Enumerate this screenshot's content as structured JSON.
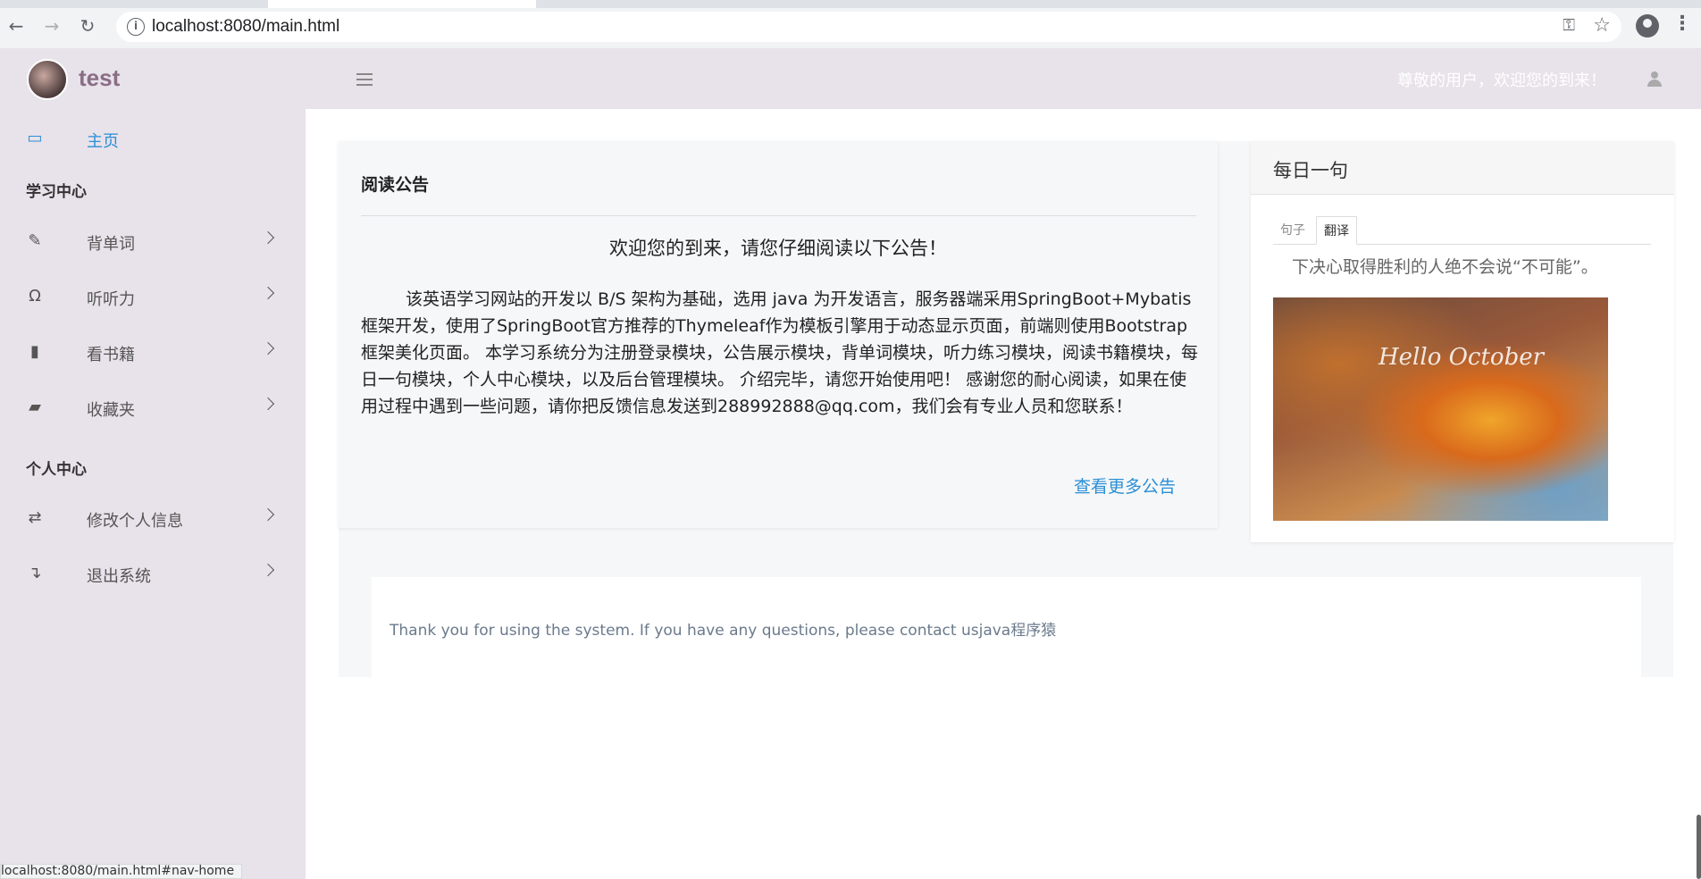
{
  "browser": {
    "url": "localhost:8080/main.html",
    "status_url": "localhost:8080/main.html#nav-home"
  },
  "brand": {
    "name": "test"
  },
  "sidebar": {
    "home": {
      "label": "主页"
    },
    "section_study": "学习中心",
    "study_items": [
      {
        "label": "背单词",
        "icon": "edit-icon"
      },
      {
        "label": "听听力",
        "icon": "headphones-icon"
      },
      {
        "label": "看书籍",
        "icon": "book-icon"
      },
      {
        "label": "收藏夹",
        "icon": "folder-open-icon"
      }
    ],
    "section_personal": "个人中心",
    "personal_items": [
      {
        "label": "修改个人信息",
        "icon": "exchange-icon"
      },
      {
        "label": "退出系统",
        "icon": "exit-icon"
      }
    ]
  },
  "header": {
    "welcome": "尊敬的用户，欢迎您的到来！"
  },
  "notice": {
    "title": "阅读公告",
    "heading": "欢迎您的到来，请您仔细阅读以下公告！",
    "body": "该英语学习网站的开发以 B/S 架构为基础，选用 java 为开发语言，服务器端采用SpringBoot+Mybatis框架开发，使用了SpringBoot官方推荐的Thymeleaf作为模板引擎用于动态显示页面，前端则使用Bootstrap 框架美化页面。 本学习系统分为注册登录模块，公告展示模块，背单词模块，听力练习模块，阅读书籍模块，每日一句模块，个人中心模块，以及后台管理模块。 介绍完毕，请您开始使用吧！ 感谢您的耐心阅读，如果在使用过程中遇到一些问题，请你把反馈信息发送到288992888@qq.com，我们会有专业人员和您联系！",
    "more_link": "查看更多公告"
  },
  "daily": {
    "title": "每日一句",
    "tabs": [
      "句子",
      "翻译"
    ],
    "active_tab": "翻译",
    "text": "下决心取得胜利的人绝不会说“不可能”。",
    "image_caption": "Hello October"
  },
  "footer": {
    "text": "Thank you for using the system. If you have any questions, please contact usjava程序猿"
  }
}
